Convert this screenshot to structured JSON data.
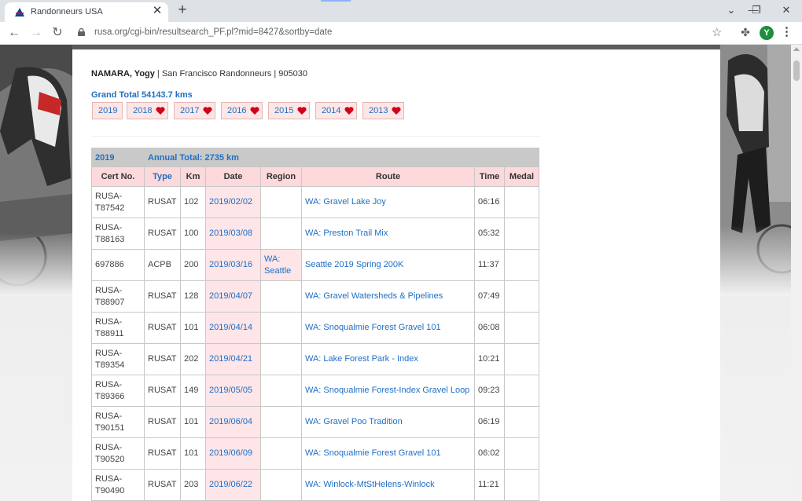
{
  "browser": {
    "tab_title": "Randonneurs USA",
    "url": "rusa.org/cgi-bin/resultsearch_PF.pl?mid=8427&sortby=date",
    "profile_initial": "Y"
  },
  "rider": {
    "name": "NAMARA, Yogy",
    "details": " | San Francisco Randonneurs | 905030",
    "grand_total": "Grand Total 54143.7 kms"
  },
  "years": [
    "2019",
    "2018",
    "2017",
    "2016",
    "2015",
    "2014",
    "2013"
  ],
  "table": {
    "year": "2019",
    "annual_total": "Annual Total: 2735 km",
    "columns": [
      "Cert No.",
      "Type",
      "Km",
      "Date",
      "Region",
      "Route",
      "Time",
      "Medal"
    ],
    "rows": [
      {
        "cert": "RUSA-T87542",
        "type": "RUSAT",
        "km": "102",
        "date": "2019/02/02",
        "region": "",
        "route": "WA: Gravel Lake Joy",
        "time": "06:16",
        "medal": ""
      },
      {
        "cert": "RUSA-T88163",
        "type": "RUSAT",
        "km": "100",
        "date": "2019/03/08",
        "region": "",
        "route": "WA: Preston Trail Mix",
        "time": "05:32",
        "medal": ""
      },
      {
        "cert": "697886",
        "type": "ACPB",
        "km": "200",
        "date": "2019/03/16",
        "region": "WA: Seattle",
        "route": "Seattle 2019 Spring 200K",
        "time": "11:37",
        "medal": ""
      },
      {
        "cert": "RUSA-T88907",
        "type": "RUSAT",
        "km": "128",
        "date": "2019/04/07",
        "region": "",
        "route": "WA: Gravel Watersheds & Pipelines",
        "time": "07:49",
        "medal": ""
      },
      {
        "cert": "RUSA-T88911",
        "type": "RUSAT",
        "km": "101",
        "date": "2019/04/14",
        "region": "",
        "route": "WA: Snoqualmie Forest Gravel 101",
        "time": "06:08",
        "medal": ""
      },
      {
        "cert": "RUSA-T89354",
        "type": "RUSAT",
        "km": "202",
        "date": "2019/04/21",
        "region": "",
        "route": "WA: Lake Forest Park - Index",
        "time": "10:21",
        "medal": ""
      },
      {
        "cert": "RUSA-T89366",
        "type": "RUSAT",
        "km": "149",
        "date": "2019/05/05",
        "region": "",
        "route": "WA: Snoqualmie Forest-Index Gravel Loop",
        "time": "09:23",
        "medal": ""
      },
      {
        "cert": "RUSA-T90151",
        "type": "RUSAT",
        "km": "101",
        "date": "2019/06/04",
        "region": "",
        "route": "WA: Gravel Poo Tradition",
        "time": "06:19",
        "medal": ""
      },
      {
        "cert": "RUSA-T90520",
        "type": "RUSAT",
        "km": "101",
        "date": "2019/06/09",
        "region": "",
        "route": "WA: Snoqualmie Forest Gravel 101",
        "time": "06:02",
        "medal": ""
      },
      {
        "cert": "RUSA-T90490",
        "type": "RUSAT",
        "km": "203",
        "date": "2019/06/22",
        "region": "",
        "route": "WA: Winlock-MtStHelens-Winlock",
        "time": "11:21",
        "medal": ""
      }
    ]
  },
  "colors": {
    "link": "#1f6fc5",
    "header_pink": "#fdd9dc",
    "cell_pink": "#fde5e8",
    "heart": "#d0021b"
  }
}
